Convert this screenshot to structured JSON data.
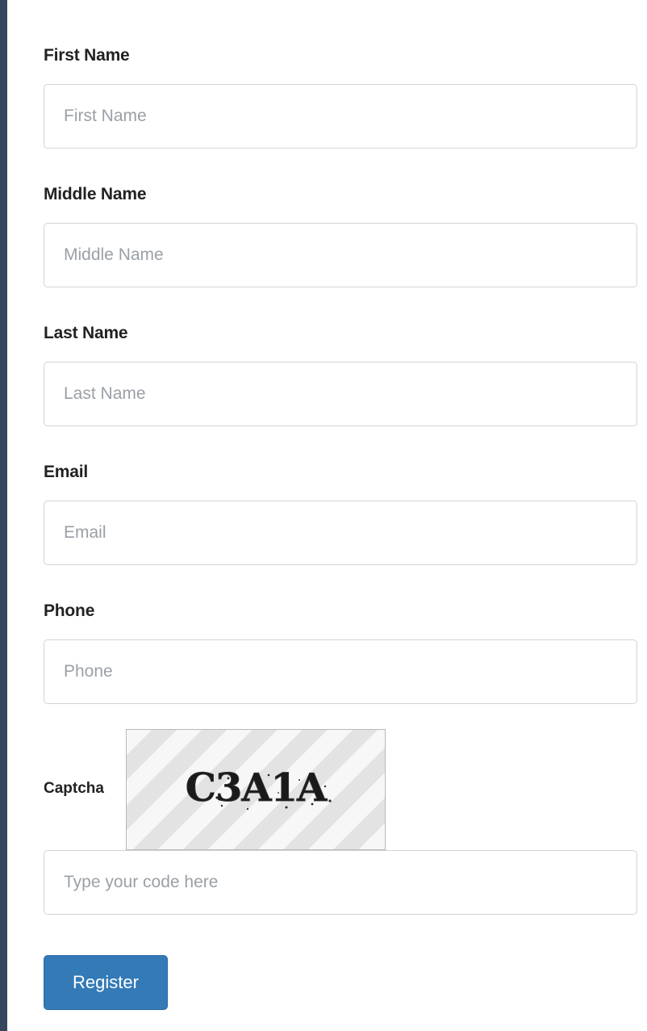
{
  "form": {
    "first_name": {
      "label": "First Name",
      "placeholder": "First Name",
      "value": ""
    },
    "middle_name": {
      "label": "Middle Name",
      "placeholder": "Middle Name",
      "value": ""
    },
    "last_name": {
      "label": "Last Name",
      "placeholder": "Last Name",
      "value": ""
    },
    "email": {
      "label": "Email",
      "placeholder": "Email",
      "value": ""
    },
    "phone": {
      "label": "Phone",
      "placeholder": "Phone",
      "value": ""
    },
    "captcha": {
      "label": "Captcha",
      "code": "C3A1A",
      "input_placeholder": "Type your code here",
      "value": ""
    },
    "register_label": "Register"
  },
  "colors": {
    "accent": "#337ab7",
    "frame_border": "#35475e",
    "input_border": "#cfd4da",
    "placeholder": "#9aa0a6"
  }
}
